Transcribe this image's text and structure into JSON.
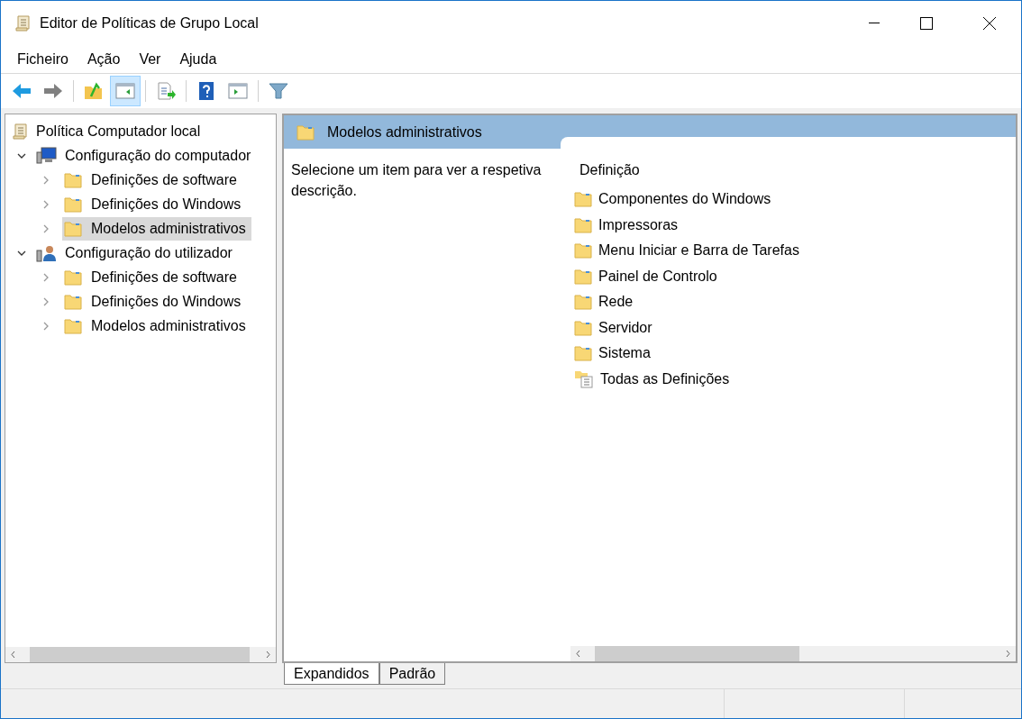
{
  "window": {
    "title": "Editor de Políticas de Grupo Local"
  },
  "menu": [
    "Ficheiro",
    "Ação",
    "Ver",
    "Ajuda"
  ],
  "toolbar": [
    {
      "kind": "back",
      "selected": false
    },
    {
      "kind": "forward",
      "selected": false
    },
    {
      "kind": "sep"
    },
    {
      "kind": "up",
      "selected": false
    },
    {
      "kind": "pane",
      "selected": true
    },
    {
      "kind": "sep"
    },
    {
      "kind": "export",
      "selected": false
    },
    {
      "kind": "sep"
    },
    {
      "kind": "help",
      "selected": false
    },
    {
      "kind": "action",
      "selected": false
    },
    {
      "kind": "sep"
    },
    {
      "kind": "filter",
      "selected": false
    }
  ],
  "tree": {
    "label": "Política Computador local",
    "children": [
      {
        "label": "Configuração do computador",
        "kind": "computer",
        "expanded": true,
        "children": [
          {
            "label": "Definições de software",
            "selected": false
          },
          {
            "label": "Definições do Windows",
            "selected": false
          },
          {
            "label": "Modelos administrativos",
            "selected": true
          }
        ]
      },
      {
        "label": "Configuração do utilizador",
        "kind": "user",
        "expanded": true,
        "children": [
          {
            "label": "Definições de software",
            "selected": false
          },
          {
            "label": "Definições do Windows",
            "selected": false
          },
          {
            "label": "Modelos administrativos",
            "selected": false
          }
        ]
      }
    ]
  },
  "details": {
    "title": "Modelos administrativos",
    "description": "Selecione um item para ver a respetiva descrição.",
    "column": "Definição",
    "items": [
      {
        "label": "Componentes do Windows",
        "kind": "folder"
      },
      {
        "label": "Impressoras",
        "kind": "folder"
      },
      {
        "label": "Menu Iniciar e Barra de Tarefas",
        "kind": "folder"
      },
      {
        "label": "Painel de Controlo",
        "kind": "folder"
      },
      {
        "label": "Rede",
        "kind": "folder"
      },
      {
        "label": "Servidor",
        "kind": "folder"
      },
      {
        "label": "Sistema",
        "kind": "folder"
      },
      {
        "label": "Todas as Definições",
        "kind": "all"
      }
    ]
  },
  "tabs": [
    {
      "label": "Expandidos",
      "selected": true
    },
    {
      "label": "Padrão",
      "selected": false
    }
  ]
}
